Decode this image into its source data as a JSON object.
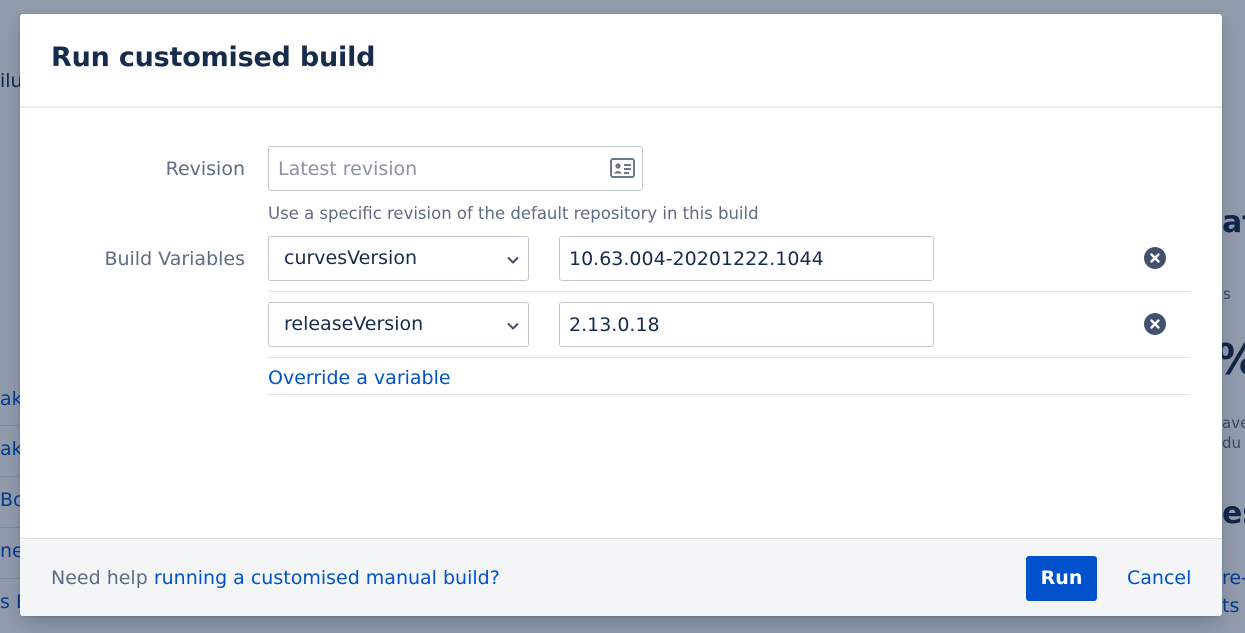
{
  "background": {
    "fragments": [
      "ilu",
      "ake",
      "ake",
      "Bo",
      "ner",
      "s B",
      "at",
      "s",
      "%",
      "ave",
      "du",
      "es",
      "re-",
      "ts"
    ]
  },
  "dialog": {
    "title": "Run customised build",
    "revision": {
      "label": "Revision",
      "placeholder": "Latest revision",
      "value": "",
      "icon": "id-card-icon",
      "hint": "Use a specific revision of the default repository in this build"
    },
    "build_variables": {
      "label": "Build Variables",
      "rows": [
        {
          "name": "curvesVersion",
          "value": "10.63.004-20201222.1044"
        },
        {
          "name": "releaseVersion",
          "value": "2.13.0.18"
        }
      ],
      "override_link": "Override a variable"
    },
    "footer": {
      "help_text": "Need help",
      "help_link": "running a customised manual build?",
      "run_label": "Run",
      "cancel_label": "Cancel"
    }
  },
  "colors": {
    "primary": "#0052cc",
    "text": "#172b4d",
    "subtle_text": "#5e6c84",
    "overlay": "#8f97a6"
  }
}
